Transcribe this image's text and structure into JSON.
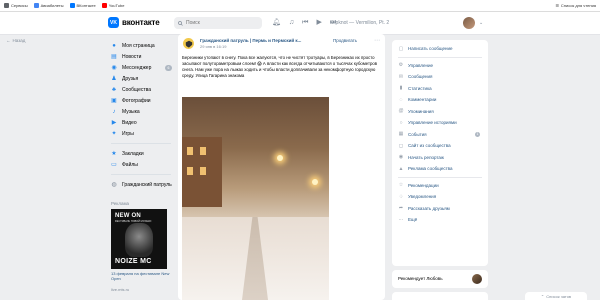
{
  "bookmarks": {
    "items": [
      {
        "label": "Сервисы",
        "color": "#5f6368"
      },
      {
        "label": "Авиабилеты",
        "color": "#4285f4"
      },
      {
        "label": "ВКонтакте",
        "color": "#0077ff"
      },
      {
        "label": "YouTube",
        "color": "#ff0000"
      }
    ],
    "reading_list": "Список для чтения"
  },
  "header": {
    "brand": "вконтакте",
    "logo_letters": "VK",
    "search_placeholder": "Поиск",
    "now_playing": "Slipknot — Vermilion, Pt. 2",
    "icons": [
      "bell-icon",
      "headphones-icon",
      "prev-icon",
      "play-icon",
      "next-icon"
    ]
  },
  "back_link": "Назад",
  "nav": {
    "items": [
      {
        "label": "Моя страница",
        "icon": "user-icon",
        "badge": null
      },
      {
        "label": "Новости",
        "icon": "news-icon",
        "badge": null
      },
      {
        "label": "Мессенджер",
        "icon": "message-icon",
        "badge": "6"
      },
      {
        "label": "Друзья",
        "icon": "friends-icon",
        "badge": null
      },
      {
        "label": "Сообщества",
        "icon": "groups-icon",
        "badge": null
      },
      {
        "label": "Фотографии",
        "icon": "photo-icon",
        "badge": null
      },
      {
        "label": "Музыка",
        "icon": "music-icon",
        "badge": null
      },
      {
        "label": "Видео",
        "icon": "video-icon",
        "badge": null
      },
      {
        "label": "Игры",
        "icon": "games-icon",
        "badge": null
      }
    ],
    "secondary": [
      {
        "label": "Закладки",
        "icon": "bookmark-icon"
      },
      {
        "label": "Файлы",
        "icon": "file-icon"
      }
    ],
    "tertiary": [
      {
        "label": "Гражданский патруль",
        "icon": "group-avatar-icon"
      }
    ]
  },
  "ad": {
    "label": "Реклама",
    "title": "NEW ON",
    "subtitle": "ФЕСТИВАЛЬ НОВОЙ МУЗЫКИ",
    "bottom_text": "NOIZE MC",
    "caption": "13 февраля на фестивале New Open",
    "domain": "live.mts.ru"
  },
  "post": {
    "author": "Гражданский патруль | Пермь и Пермский к...",
    "date": "29 янв в 16:19",
    "promote": "Продвигать",
    "text": "Березники утопают в снегу. Пока все жалуются, что не чистят тротуары, в Березниках их просто засыпают полутораметровым слоем! 😱 А власти как всегда отчитываются о тысячах кубометров снега. Нам уже пора на лыжах ходить и чтобы власти доплачивали за некомфортную городскую среду. Улица Гагарина знакома"
  },
  "right_panel": {
    "items": [
      {
        "label": "Написать сообщение",
        "icon": "chat-icon"
      },
      {
        "label": "Управление",
        "icon": "settings-icon"
      },
      {
        "label": "Сообщения",
        "icon": "mail-icon"
      },
      {
        "label": "Статистика",
        "icon": "stats-icon"
      },
      {
        "label": "Комментарии",
        "icon": "comment-icon"
      },
      {
        "label": "Упоминания",
        "icon": "mention-icon"
      },
      {
        "label": "Управление историями",
        "icon": "stories-icon"
      },
      {
        "label": "События",
        "icon": "event-icon",
        "badge": "1"
      },
      {
        "label": "Сайт из сообщества",
        "icon": "site-icon"
      },
      {
        "label": "Начать репортаж",
        "icon": "live-icon"
      },
      {
        "label": "Реклама сообщества",
        "icon": "ad-icon"
      },
      {
        "label": "Рекомендации",
        "icon": "recommend-icon"
      },
      {
        "label": "Уведомления",
        "icon": "notify-icon"
      },
      {
        "label": "Рассказать друзьям",
        "icon": "share-icon"
      },
      {
        "label": "Ещё",
        "icon": "more-icon"
      }
    ],
    "recommend": "Рекомендует Любовь"
  },
  "chat_tab": "Список чатов"
}
